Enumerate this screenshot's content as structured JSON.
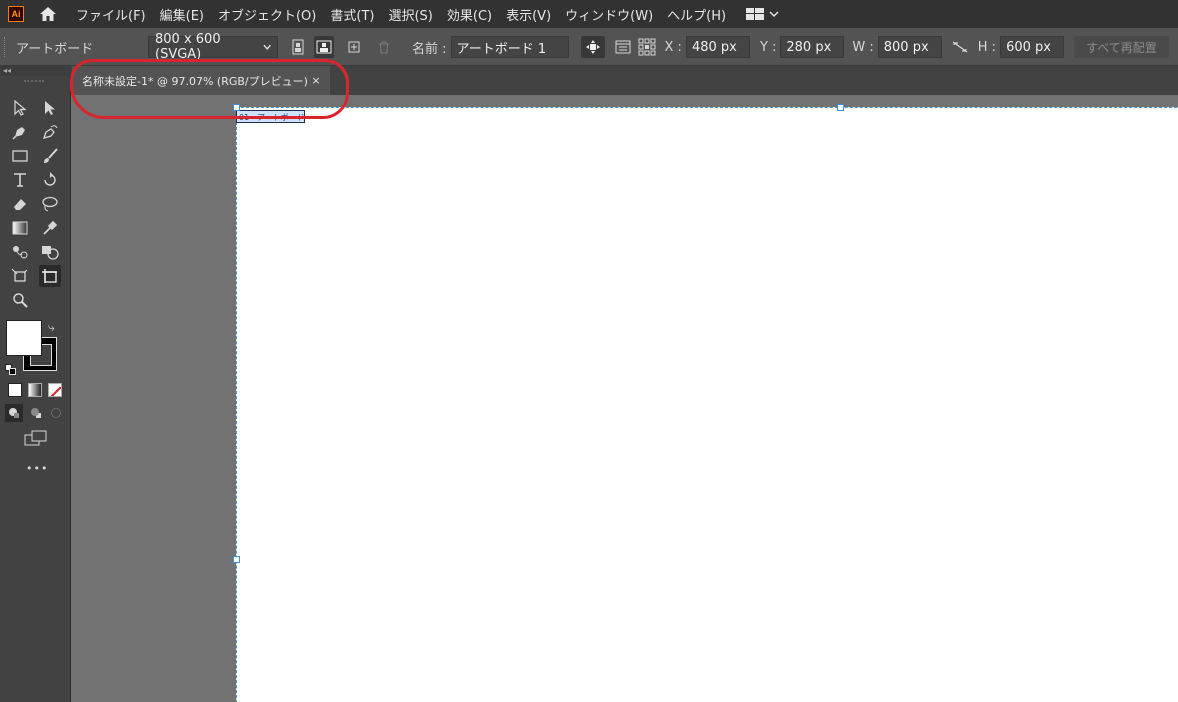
{
  "app": {
    "logo": "Ai"
  },
  "menu": [
    "ファイル(F)",
    "編集(E)",
    "オブジェクト(O)",
    "書式(T)",
    "選択(S)",
    "効果(C)",
    "表示(V)",
    "ウィンドウ(W)",
    "ヘルプ(H)"
  ],
  "control": {
    "context_label": "アートボード",
    "preset": "800 x 600 (SVGA)",
    "name_label": "名前 :",
    "name_value": "アートボード 1",
    "x_label": "X :",
    "x_value": "480 px",
    "y_label": "Y :",
    "y_value": "280 px",
    "w_label": "W :",
    "w_value": "800 px",
    "h_label": "H :",
    "h_value": "600 px",
    "reflow_label": "すべて再配置"
  },
  "document": {
    "tab_title": "名称未設定-1* @ 97.07% (RGB/プレビュー)",
    "tab_close": "×",
    "artboard_label": "01 - アートボード 1"
  },
  "toolbar": {
    "more": "•••"
  },
  "colors": {
    "accent": "#d9262e",
    "selection": "#3d8fd9",
    "ui_dark": "#323232",
    "ui_panel": "#424242",
    "ui_mid": "#535353",
    "canvas": "#727272"
  }
}
